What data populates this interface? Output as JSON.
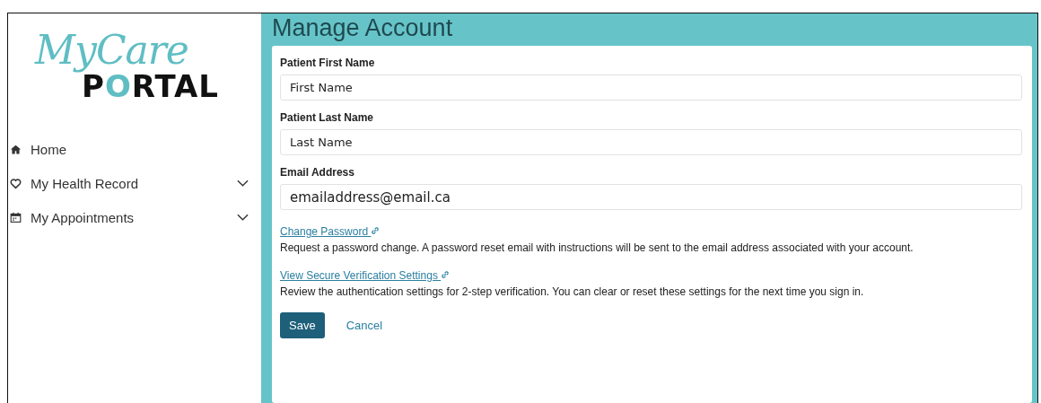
{
  "logo": {
    "script": "MyCare",
    "word": "PORTAL"
  },
  "nav": [
    {
      "label": "Home",
      "kind": "home",
      "expandable": false
    },
    {
      "label": "My Health Record",
      "kind": "heart",
      "expandable": true
    },
    {
      "label": "My Appointments",
      "kind": "calendar",
      "expandable": true
    }
  ],
  "page": {
    "title": "Manage Account"
  },
  "fields": [
    {
      "label": "Patient First Name",
      "value": "First Name"
    },
    {
      "label": "Patient Last Name",
      "value": "Last Name"
    },
    {
      "label": "Email Address",
      "value": "emailaddress@email.ca"
    }
  ],
  "links": [
    {
      "label": "Change Password",
      "description": "Request a password change. A password reset email with instructions will be sent to the email address associated with your account."
    },
    {
      "label": "View Secure Verification Settings",
      "description": "Review the authentication settings for 2-step verification. You can clear or reset these settings for the next time you sign in."
    }
  ],
  "buttons": [
    {
      "label": "Save",
      "kind": "primary"
    },
    {
      "label": "Cancel",
      "kind": "link"
    }
  ]
}
